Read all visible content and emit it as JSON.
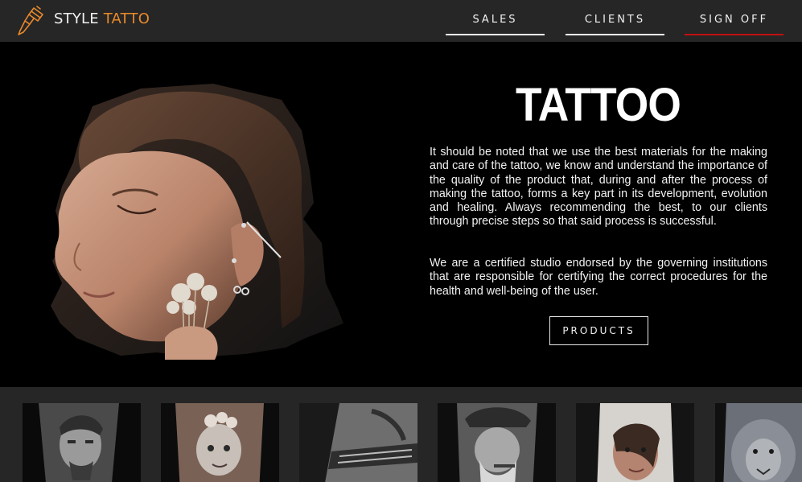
{
  "brand": {
    "name_part1": "STYLE",
    "name_part2": "TATTO",
    "logo_icon": "tattoo-machine-icon",
    "accent_color": "#e8892c"
  },
  "nav": {
    "items": [
      {
        "label": "SALES"
      },
      {
        "label": "CLIENTS"
      },
      {
        "label": "SIGN OFF"
      }
    ],
    "active_underline_color": "#c21010"
  },
  "hero": {
    "title": "TATTOO",
    "paragraph1": "It should be noted that we use the best materials for the making and care of the tattoo, we know and understand the importance of the quality of the product that, during and after the process of making the tattoo, forms a key part in its development, evolution and healing. Always recommending the best, to our clients through precise steps so that said process is successful.",
    "paragraph2": "We are a certified studio endorsed by the governing institutions that are responsible for certifying the correct procedures for the health and well-being of the user.",
    "cta_label": "PRODUCTS"
  },
  "gallery": {
    "items": [
      {
        "subject": "pirate-portrait-tattoo"
      },
      {
        "subject": "child-portrait-tattoo"
      },
      {
        "subject": "sleeve-pattern-tattoo"
      },
      {
        "subject": "old-man-portrait-tattoo"
      },
      {
        "subject": "woman-hood-portrait-tattoo"
      },
      {
        "subject": "lion-tattoo"
      }
    ]
  }
}
